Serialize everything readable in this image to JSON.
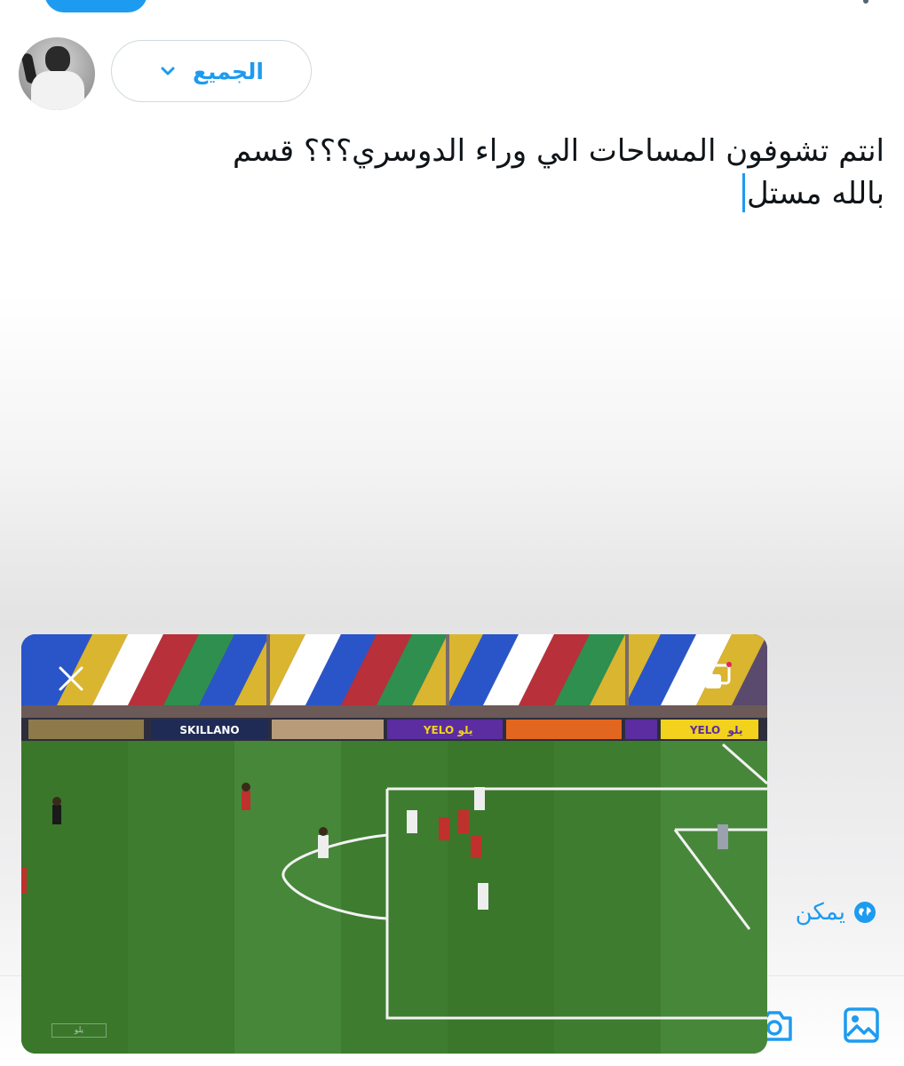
{
  "composer": {
    "audience_label": "الجميع",
    "text_line1": "انتم تشوفون المساحات الي وراء الدوسري؟؟؟ قسم",
    "text_line2": "بالله مستل"
  },
  "reply_setting": {
    "label": "يمكن"
  },
  "video": {
    "ad_boards": [
      "SKILLANO",
      "YELO",
      "يلو",
      "YELO",
      "يلو"
    ],
    "watermark": "يلو"
  },
  "icons": {
    "close": "close-icon",
    "pip": "picture-in-picture-icon",
    "camera": "camera-icon",
    "image": "image-icon",
    "globe": "globe-icon",
    "chevron": "chevron-down-icon"
  },
  "colors": {
    "accent": "#1d9bf0",
    "pitch_dark": "#3b7a2c",
    "pitch_light": "#4a8b34",
    "text": "#0f1419"
  }
}
